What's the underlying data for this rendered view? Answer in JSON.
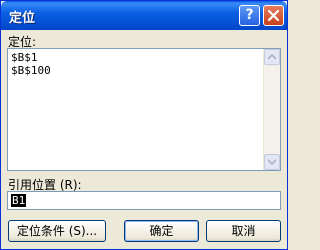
{
  "window": {
    "title": "定位",
    "help_icon": "?",
    "close_icon": "close"
  },
  "goto_list": {
    "label": "定位:",
    "items": [
      "$B$1",
      "$B$100"
    ]
  },
  "reference": {
    "label": "引用位置 (R):",
    "value": "B1"
  },
  "buttons": {
    "special": "定位条件 (S)...",
    "ok": "确定",
    "cancel": "取消"
  }
}
